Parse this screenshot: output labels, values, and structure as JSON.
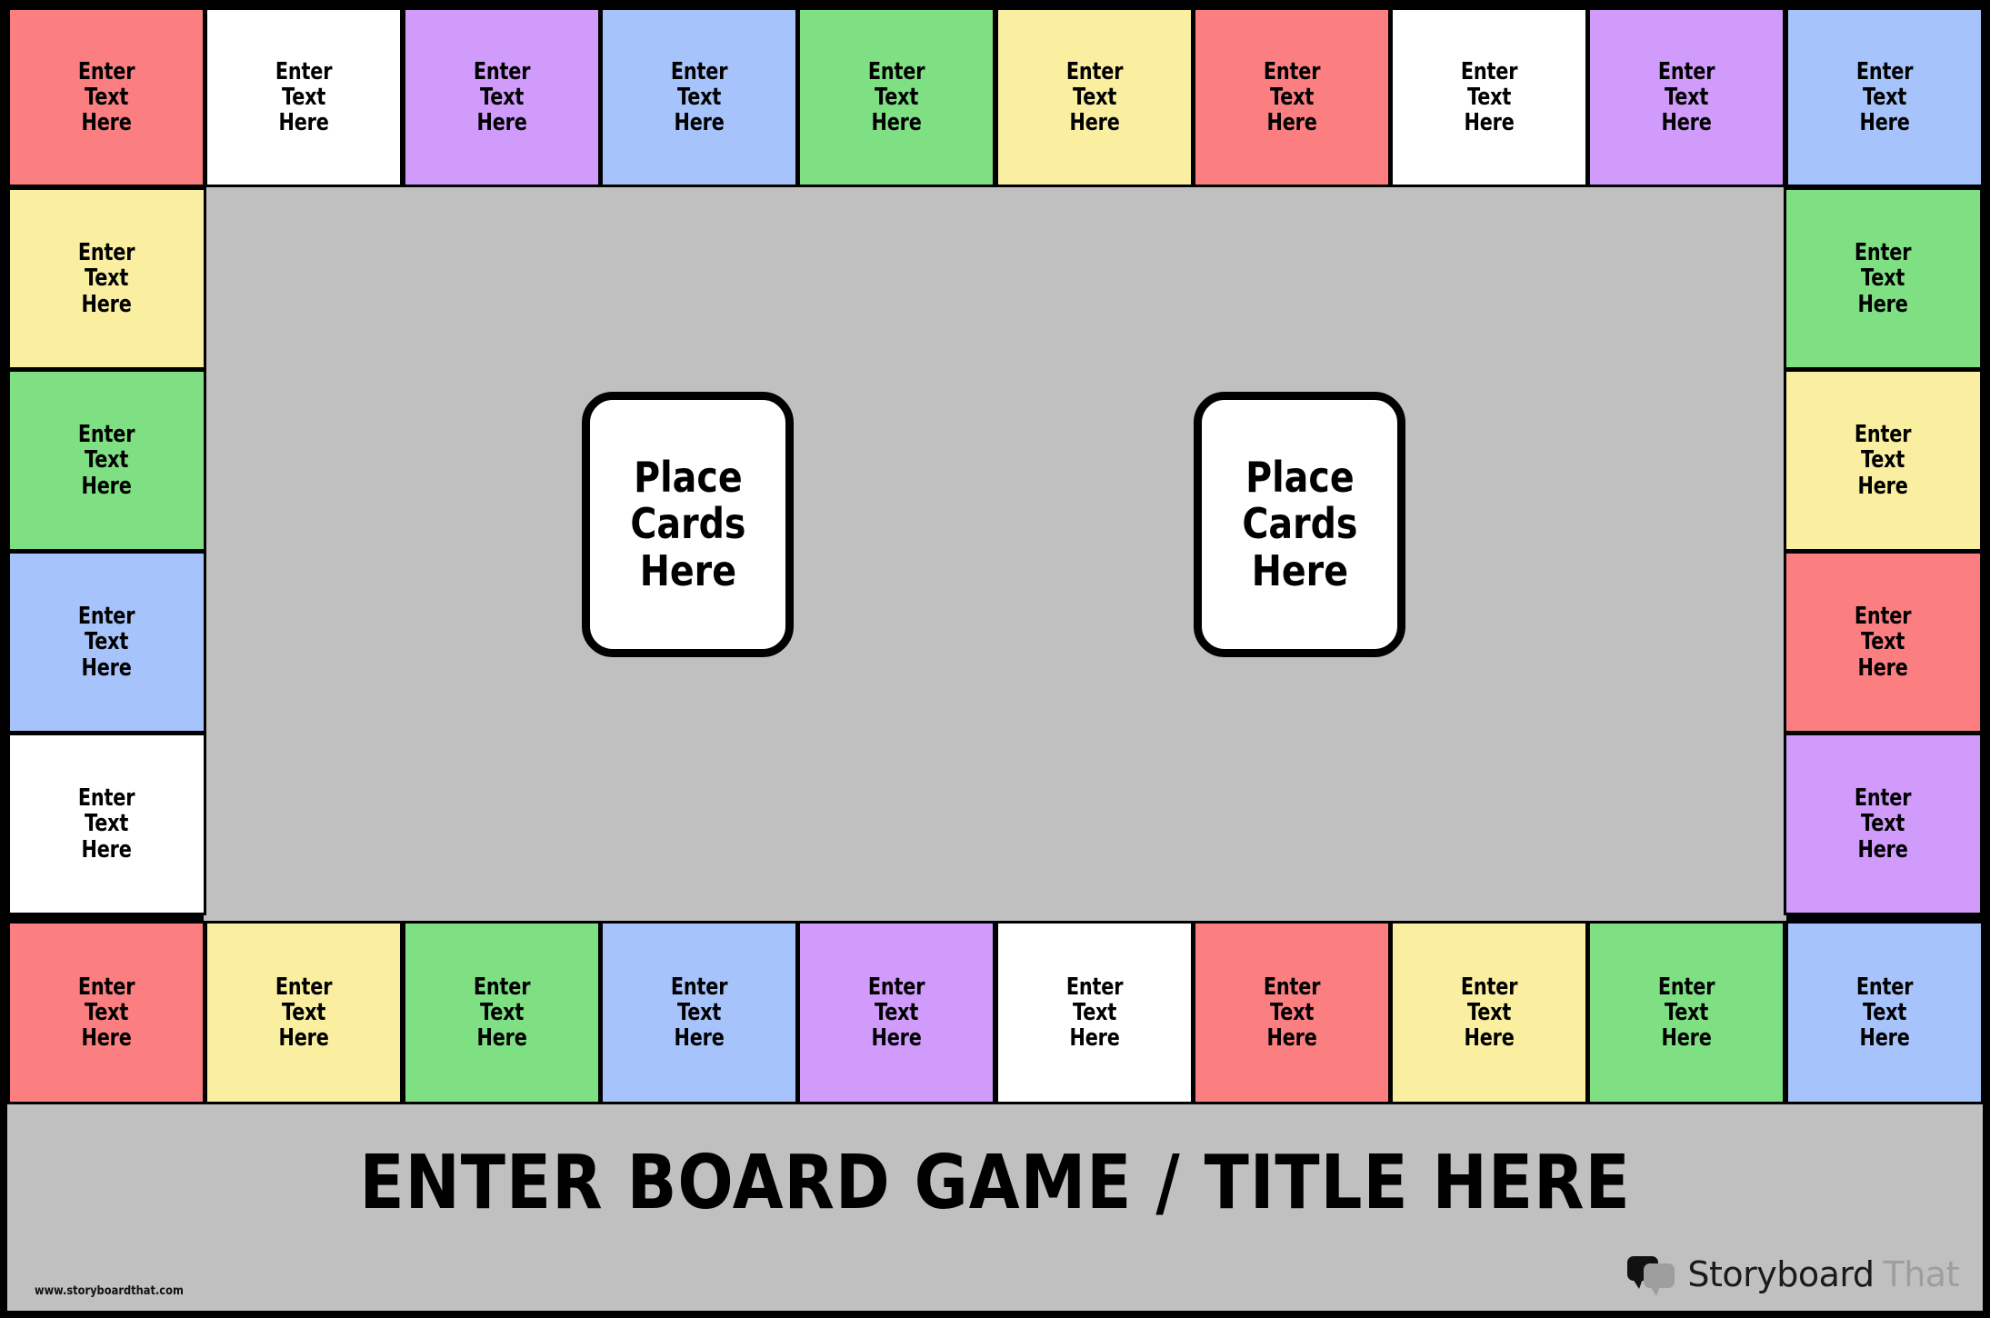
{
  "board": {
    "title": "ENTER BOARD GAME / TITLE HERE",
    "cell_placeholder": "Enter\nText\nHere",
    "background_color": "#C0C0C0",
    "border_color": "#000000",
    "palette": {
      "red": "#FB7F80",
      "white": "#FFFFFF",
      "purple": "#D09BFB",
      "blue": "#A6C3FB",
      "green": "#7EE083",
      "yellow": "#FAEFA0",
      "gray": "#C0C0C0"
    }
  },
  "card_slots": [
    {
      "label": "Place\nCards\nHere"
    },
    {
      "label": "Place\nCards\nHere"
    }
  ],
  "top_row": [
    {
      "label": "Enter\nText\nHere",
      "color": "red"
    },
    {
      "label": "Enter\nText\nHere",
      "color": "white"
    },
    {
      "label": "Enter\nText\nHere",
      "color": "purple"
    },
    {
      "label": "Enter\nText\nHere",
      "color": "blue"
    },
    {
      "label": "Enter\nText\nHere",
      "color": "green"
    },
    {
      "label": "Enter\nText\nHere",
      "color": "yellow"
    },
    {
      "label": "Enter\nText\nHere",
      "color": "red"
    },
    {
      "label": "Enter\nText\nHere",
      "color": "white"
    },
    {
      "label": "Enter\nText\nHere",
      "color": "purple"
    },
    {
      "label": "Enter\nText\nHere",
      "color": "blue"
    }
  ],
  "left_column": [
    {
      "label": "Enter\nText\nHere",
      "color": "yellow"
    },
    {
      "label": "Enter\nText\nHere",
      "color": "green"
    },
    {
      "label": "Enter\nText\nHere",
      "color": "blue"
    },
    {
      "label": "Enter\nText\nHere",
      "color": "white"
    }
  ],
  "right_column": [
    {
      "label": "Enter\nText\nHere",
      "color": "green"
    },
    {
      "label": "Enter\nText\nHere",
      "color": "yellow"
    },
    {
      "label": "Enter\nText\nHere",
      "color": "red"
    },
    {
      "label": "Enter\nText\nHere",
      "color": "purple"
    }
  ],
  "bottom_row": [
    {
      "label": "Enter\nText\nHere",
      "color": "red"
    },
    {
      "label": "Enter\nText\nHere",
      "color": "yellow"
    },
    {
      "label": "Enter\nText\nHere",
      "color": "green"
    },
    {
      "label": "Enter\nText\nHere",
      "color": "blue"
    },
    {
      "label": "Enter\nText\nHere",
      "color": "purple"
    },
    {
      "label": "Enter\nText\nHere",
      "color": "white"
    },
    {
      "label": "Enter\nText\nHere",
      "color": "red"
    },
    {
      "label": "Enter\nText\nHere",
      "color": "yellow"
    },
    {
      "label": "Enter\nText\nHere",
      "color": "green"
    },
    {
      "label": "Enter\nText\nHere",
      "color": "blue"
    }
  ],
  "footer": {
    "url": "www.storyboardthat.com",
    "brand_primary": "Storyboard",
    "brand_secondary": "That"
  }
}
